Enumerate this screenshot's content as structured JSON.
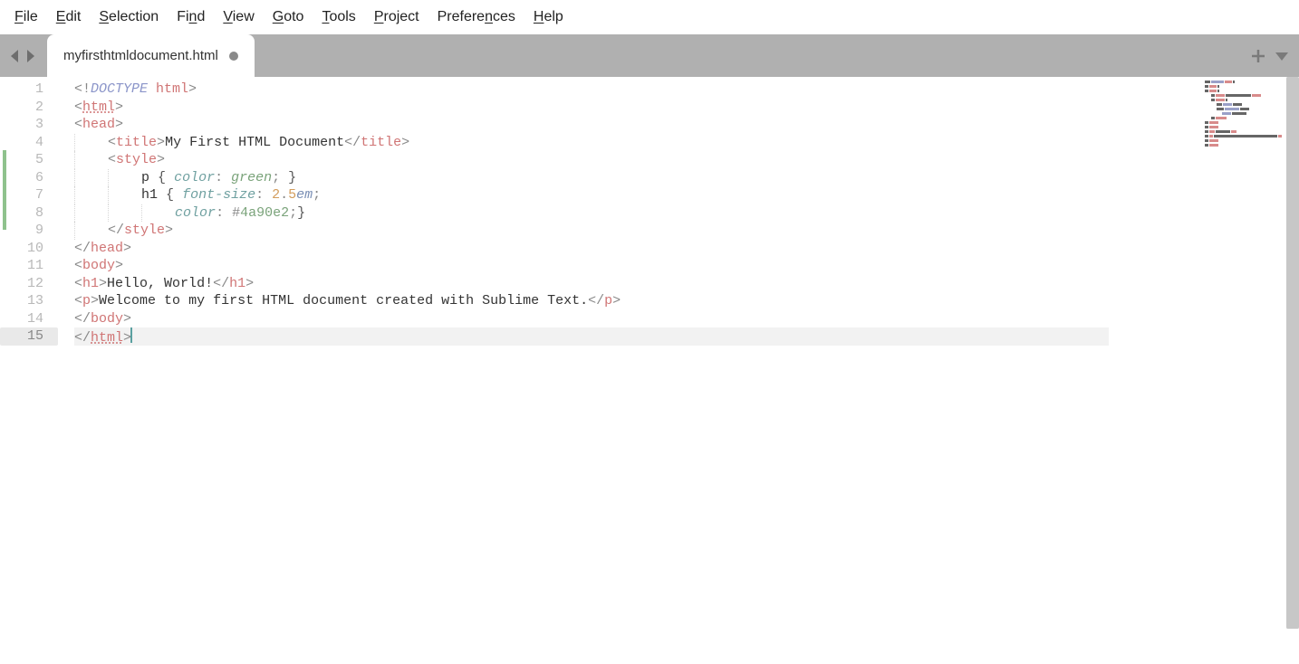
{
  "menu": {
    "items": [
      {
        "mnemonic": "F",
        "rest": "ile"
      },
      {
        "mnemonic": "E",
        "rest": "dit"
      },
      {
        "mnemonic": "S",
        "rest": "election"
      },
      {
        "mnemonic": "",
        "rest": "Fi",
        "mnemonic2": "n",
        "rest2": "d"
      },
      {
        "mnemonic": "V",
        "rest": "iew"
      },
      {
        "mnemonic": "G",
        "rest": "oto"
      },
      {
        "mnemonic": "T",
        "rest": "ools"
      },
      {
        "mnemonic": "P",
        "rest": "roject"
      },
      {
        "mnemonic": "",
        "rest": "Prefere",
        "mnemonic2": "n",
        "rest2": "ces"
      },
      {
        "mnemonic": "H",
        "rest": "elp"
      }
    ]
  },
  "tabs": {
    "active": {
      "title": "myfirsthtmldocument.html",
      "dirty": true
    }
  },
  "editor": {
    "line_count": 15,
    "active_line": 15,
    "lines": [
      {
        "n": 1,
        "tokens": [
          [
            "angle",
            "<!"
          ],
          [
            "doctype",
            "DOCTYPE "
          ],
          [
            "tag",
            "html"
          ],
          [
            "angle",
            ">"
          ]
        ]
      },
      {
        "n": 2,
        "tokens": [
          [
            "angle",
            "<"
          ],
          [
            "tag-u",
            "html"
          ],
          [
            "angle",
            ">"
          ]
        ]
      },
      {
        "n": 3,
        "tokens": [
          [
            "angle",
            "<"
          ],
          [
            "tag",
            "head"
          ],
          [
            "angle",
            ">"
          ]
        ]
      },
      {
        "n": 4,
        "indent": 1,
        "tokens": [
          [
            "angle",
            "<"
          ],
          [
            "tag",
            "title"
          ],
          [
            "angle",
            ">"
          ],
          [
            "text",
            "My First HTML Document"
          ],
          [
            "angle",
            "</"
          ],
          [
            "tag",
            "title"
          ],
          [
            "angle",
            ">"
          ]
        ]
      },
      {
        "n": 5,
        "indent": 1,
        "tokens": [
          [
            "angle",
            "<"
          ],
          [
            "tag",
            "style"
          ],
          [
            "angle",
            ">"
          ]
        ]
      },
      {
        "n": 6,
        "indent": 2,
        "tokens": [
          [
            "sel",
            "p "
          ],
          [
            "brace",
            "{ "
          ],
          [
            "prop",
            "color"
          ],
          [
            "punct",
            ": "
          ],
          [
            "val",
            "green"
          ],
          [
            "punct",
            "; "
          ],
          [
            "brace",
            "}"
          ]
        ]
      },
      {
        "n": 7,
        "indent": 2,
        "tokens": [
          [
            "sel",
            "h1 "
          ],
          [
            "brace",
            "{ "
          ],
          [
            "prop",
            "font-size"
          ],
          [
            "punct",
            ": "
          ],
          [
            "num",
            "2"
          ],
          [
            "punct",
            "."
          ],
          [
            "num",
            "5"
          ],
          [
            "unit",
            "em"
          ],
          [
            "punct",
            ";"
          ]
        ]
      },
      {
        "n": 8,
        "indent": 3,
        "tokens": [
          [
            "prop",
            "color"
          ],
          [
            "punct",
            ": "
          ],
          [
            "hash",
            "#"
          ],
          [
            "hex",
            "4a90e2"
          ],
          [
            "punct",
            ";"
          ],
          [
            "brace",
            "}"
          ]
        ]
      },
      {
        "n": 9,
        "indent": 1,
        "tokens": [
          [
            "angle",
            "</"
          ],
          [
            "tag",
            "style"
          ],
          [
            "angle",
            ">"
          ]
        ]
      },
      {
        "n": 10,
        "tokens": [
          [
            "angle",
            "</"
          ],
          [
            "tag",
            "head"
          ],
          [
            "angle",
            ">"
          ]
        ]
      },
      {
        "n": 11,
        "tokens": [
          [
            "angle",
            "<"
          ],
          [
            "tag",
            "body"
          ],
          [
            "angle",
            ">"
          ]
        ]
      },
      {
        "n": 12,
        "tokens": [
          [
            "angle",
            "<"
          ],
          [
            "tag",
            "h1"
          ],
          [
            "angle",
            ">"
          ],
          [
            "text",
            "Hello, World!"
          ],
          [
            "angle",
            "</"
          ],
          [
            "tag",
            "h1"
          ],
          [
            "angle",
            ">"
          ]
        ]
      },
      {
        "n": 13,
        "tokens": [
          [
            "angle",
            "<"
          ],
          [
            "tag",
            "p"
          ],
          [
            "angle",
            ">"
          ],
          [
            "text",
            "Welcome to my first HTML document created with Sublime Text."
          ],
          [
            "angle",
            "</"
          ],
          [
            "tag",
            "p"
          ],
          [
            "angle",
            ">"
          ]
        ]
      },
      {
        "n": 14,
        "tokens": [
          [
            "angle",
            "</"
          ],
          [
            "tag",
            "body"
          ],
          [
            "angle",
            ">"
          ]
        ]
      },
      {
        "n": 15,
        "tokens": [
          [
            "angle",
            "</"
          ],
          [
            "tag-u",
            "html"
          ],
          [
            "angle",
            ">"
          ]
        ],
        "cursor_after": true
      }
    ]
  },
  "colors": {
    "minimap_a": "#d88b8b",
    "minimap_b": "#9aa0c8",
    "minimap_c": "#666666"
  }
}
